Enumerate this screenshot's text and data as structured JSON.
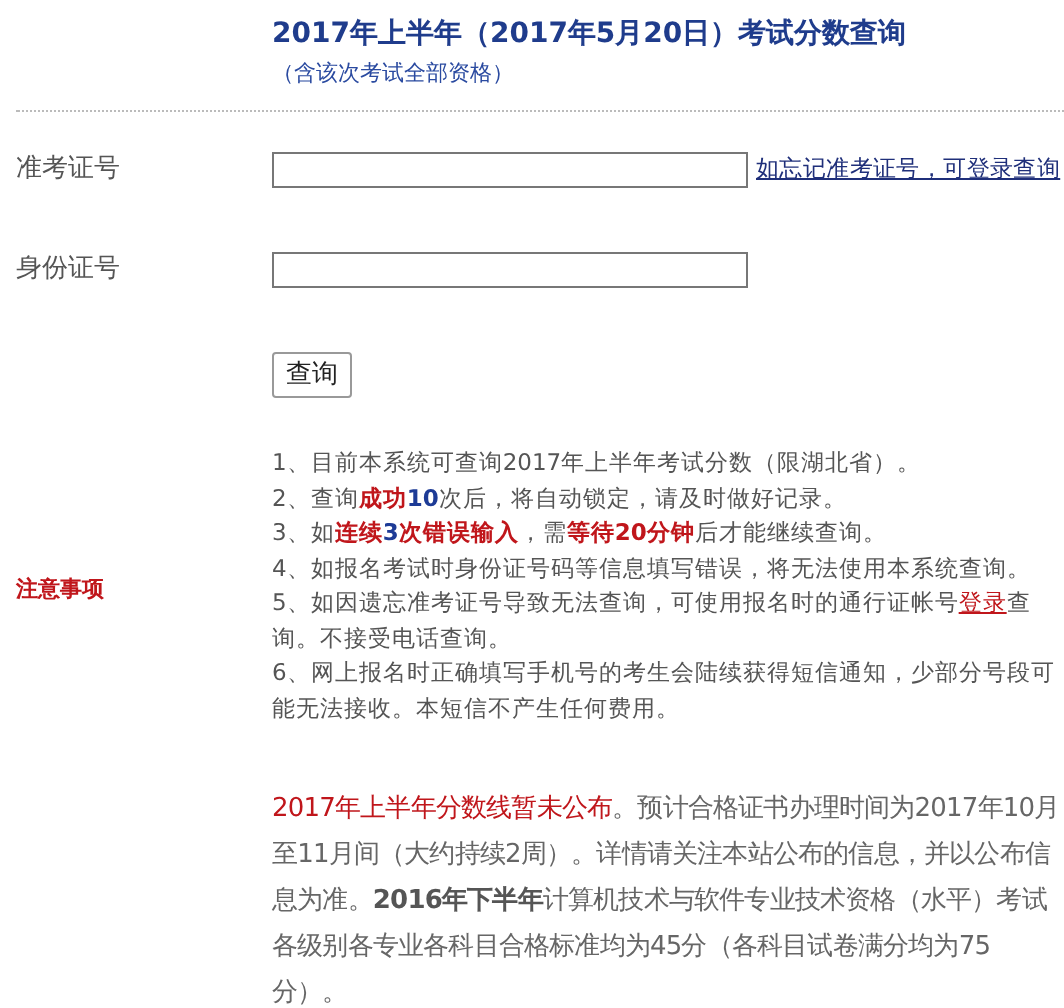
{
  "title": "2017年上半年（2017年5月20日）考试分数查询",
  "subtitle": "（含该次考试全部资格）",
  "fields": [
    {
      "label": "准考证号",
      "link": "如忘记准考证号，可登录查询"
    },
    {
      "label": "身份证号"
    }
  ],
  "submit_button": "查询",
  "notes_label": "注意事项",
  "notes": [
    [
      {
        "text": "1、目前本系统可查询2017年上半年考试分数（限湖北省）。",
        "kind": "plain"
      }
    ],
    [
      {
        "text": "2、查询",
        "kind": "plain"
      },
      {
        "text": "成功",
        "kind": "red"
      },
      {
        "text": "10",
        "kind": "blue"
      },
      {
        "text": "次后，将自动锁定，请及时做好记录。",
        "kind": "plain"
      }
    ],
    [
      {
        "text": "3、如",
        "kind": "plain"
      },
      {
        "text": "连续",
        "kind": "red"
      },
      {
        "text": "3",
        "kind": "blue"
      },
      {
        "text": "次错误输入",
        "kind": "red"
      },
      {
        "text": "，需",
        "kind": "plain"
      },
      {
        "text": "等待20分钟",
        "kind": "red"
      },
      {
        "text": "后才能继续查询。",
        "kind": "plain"
      }
    ],
    [
      {
        "text": "4、如报名考试时身份证号码等信息填写错误，将无法使用本系统查询。",
        "kind": "plain"
      }
    ],
    [
      {
        "text": "5、如因遗忘准考证号导致无法查询，可使用报名时的通行证帐号",
        "kind": "plain"
      },
      {
        "text": "登录",
        "kind": "link"
      },
      {
        "text": "查询。不接受电话查询。",
        "kind": "plain"
      }
    ],
    [
      {
        "text": "6、网上报名时正确填写手机号的考生会陆续获得短信通知，少部分号段可能无法接收。本短信不产生任何费用。",
        "kind": "plain"
      }
    ]
  ],
  "announcement": [
    {
      "text": "2017年上半年分数线暂未公布",
      "kind": "red"
    },
    {
      "text": "。预计合格证书办理时间为2017年10月至11月间（大约持续2周）。详情请关注本站公布的信息，并以公布信息为准。",
      "kind": "plain"
    },
    {
      "text": "2016年下半年",
      "kind": "bold"
    },
    {
      "text": "计算机技术与软件专业技术资格（水平）考试各级别各专业各科目合格标准均为45分（各科目试卷满分均为75分）。",
      "kind": "plain"
    }
  ]
}
